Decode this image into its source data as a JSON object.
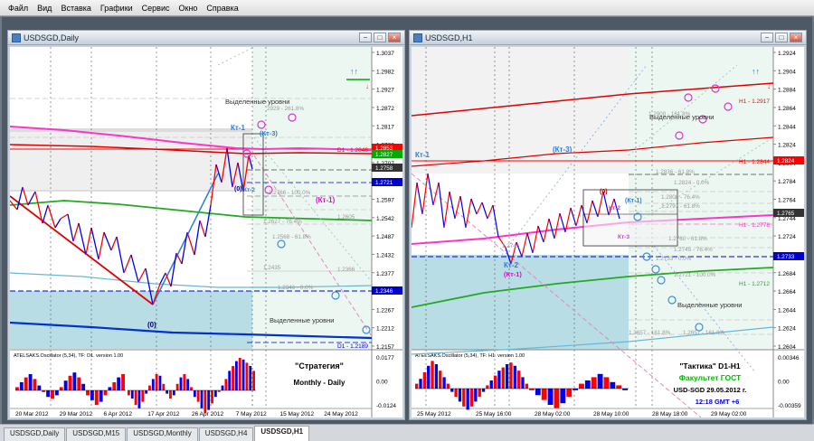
{
  "menu": [
    "Файл",
    "Вид",
    "Вставка",
    "Графики",
    "Сервис",
    "Окно",
    "Справка"
  ],
  "colors": {
    "up": "#ff0000",
    "down": "#0000ee",
    "ma_red": "#e00000",
    "ma_magenta": "#ff33cc",
    "ma_green": "#22aa22",
    "ma_blue": "#0033cc",
    "fib": "#bbbbbb",
    "zone_blue": "#b8dde5",
    "zone_gray": "#dddddd"
  },
  "left": {
    "title": "USDSGD,Daily",
    "prices": [
      "1.3037",
      "1.2982",
      "1.2927",
      "1.2872",
      "1.2817",
      "1.2762",
      "1.2707",
      "1.2652",
      "1.2597",
      "1.2542",
      "1.2487",
      "1.2432",
      "1.2377",
      "1.2322",
      "1.2267",
      "1.2212",
      "1.2157"
    ],
    "badges": [
      {
        "text": "1.2853",
        "color": "#ff0000"
      },
      {
        "text": "1.2827",
        "color": "#00aa00"
      },
      {
        "text": "1.2758",
        "color": "#333333"
      },
      {
        "text": "1.2721",
        "color": "#0000cc"
      },
      {
        "text": "1.2346",
        "color": "#0000cc"
      }
    ],
    "labels": {
      "zone_top": "Выделенные уровни",
      "zone_bottom": "Выделенные уровни",
      "kt1": "Кт-1",
      "kt3": "(Кт-3)",
      "kt2": "Кт-2",
      "kt1b": "(Кт-1)",
      "zero_top": "(0)",
      "zero_bottom": "(0)",
      "d1_top": "D1 - 1.2846",
      "d1_bottom": "D1 - 1.2189"
    },
    "fib": [
      {
        "text": "2929 - 261.8%"
      },
      {
        "text": "1.2766 - 100.0%"
      },
      {
        "text": "1.2627 - 76.4%"
      },
      {
        "text": "1.2568 - 61.8%"
      },
      {
        "text": "1.2435"
      },
      {
        "text": "1.2346 - 0.0%"
      },
      {
        "text": "1.2605"
      },
      {
        "text": "1.2366"
      }
    ],
    "osc": {
      "title": "ATELSAKS.Oscillator (5,34), TF: D1. version 1.00",
      "levels": [
        "0.0177",
        "0.00",
        "-0.0124"
      ],
      "note1": "\"Стратегия\"",
      "note2": "Monthly - Daily"
    },
    "dates": [
      "20 Mar 2012",
      "29 Mar 2012",
      "6 Apr 2012",
      "17 Apr 2012",
      "26 Apr 2012",
      "7 May 2012",
      "15 May 2012",
      "24 May 2012"
    ]
  },
  "right": {
    "title": "USDSGD,H1",
    "prices": [
      "1.2924",
      "1.2904",
      "1.2884",
      "1.2864",
      "1.2844",
      "1.2824",
      "1.2804",
      "1.2784",
      "1.2764",
      "1.2744",
      "1.2724",
      "1.2704",
      "1.2684",
      "1.2664",
      "1.2644",
      "1.2624",
      "1.2604"
    ],
    "badges": [
      {
        "text": "1.2824",
        "color": "#ff0000"
      },
      {
        "text": "1.2765",
        "color": "#333333"
      },
      {
        "text": "1.2733",
        "color": "#0000cc"
      }
    ],
    "labels": {
      "zone_top": "Выделенные уровни",
      "zone_bottom": "Выделенные уровни",
      "kt1": "Кт-1",
      "kt3": "(Кт-3)",
      "zero": "(0)",
      "kt1b": "(Кт-1)",
      "kt2r": "Кт-2",
      "kt3r": "Кт-3",
      "kt2b": "Кт-2",
      "kt1c": "(Кт-1)",
      "h1_a": "H1 - 1.2917",
      "h1_b": "H1 - 1.2844",
      "h1_c": "H1 - 1.2778",
      "h1_d": "H1 - 1.2712"
    },
    "fib": [
      {
        "text": "1.2900 - 161.8%"
      },
      {
        "text": "1.2836 - 61.8%"
      },
      {
        "text": "1.2824 - 0.0%"
      },
      {
        "text": "1.2806 - 76.4%"
      },
      {
        "text": "1.2797 - 61.8%"
      },
      {
        "text": "1.2760 - 61.8%"
      },
      {
        "text": "1.2745 - 76.4%"
      },
      {
        "text": "1.2733 - 0.0%"
      },
      {
        "text": "1.2721 - 100.0%"
      },
      {
        "text": "1.2745"
      },
      {
        "text": "1.2657 - 161.8%"
      },
      {
        "text": "1.2657 - 161.8%"
      }
    ],
    "osc": {
      "title": "ATELSAKS.Oscillator (5,34), TF: H1. version 1.00",
      "levels": [
        "0.00346",
        "0.00",
        "-0.00359"
      ],
      "note1": "\"Тактика\"   D1-H1",
      "note2": "Факультет ГОСТ",
      "note3": "USD-SGD  29.05.2012 г.",
      "note4": "12:18  GMT +6"
    },
    "dates": [
      "25 May 2012",
      "25 May 16:00",
      "28 May 02:00",
      "28 May 10:00",
      "28 May 18:00",
      "29 May 02:00"
    ]
  },
  "tabs": [
    "USDSGD,Daily",
    "USDSGD,M15",
    "USDSGD,Monthly",
    "USDSGD,H4",
    "USDSGD,H1"
  ],
  "active_tab": "USDSGD,H1"
}
